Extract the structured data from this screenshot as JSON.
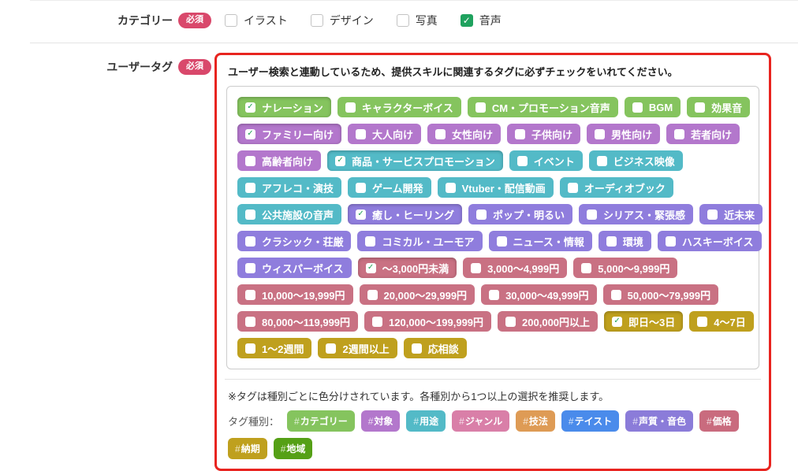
{
  "colors": {
    "category": "#85c45e",
    "target": "#b377cc",
    "usage": "#53bac7",
    "taste": "#8f7ddd",
    "voice": "#8f7ddd",
    "price": "#c97183",
    "delivery": "#bfa01e",
    "required_badge": "#d9486b",
    "panel_border": "#e8241f",
    "checkbox_checked_bg": "#1fa25e",
    "tag_check_green": "#1e9e53"
  },
  "category_row": {
    "label": "カテゴリー",
    "required_badge": "必須",
    "options": [
      {
        "label": "イラスト",
        "checked": false
      },
      {
        "label": "デザイン",
        "checked": false
      },
      {
        "label": "写真",
        "checked": false
      },
      {
        "label": "音声",
        "checked": true
      }
    ]
  },
  "user_tag_row": {
    "label": "ユーザータグ",
    "required_badge": "必須",
    "instruction": "ユーザー検索と連動しているため、提供スキルに関連するタグに必ずチェックをいれてください。",
    "tag_rows": [
      [
        {
          "label": "ナレーション",
          "checked": true,
          "group": "category"
        },
        {
          "label": "キャラクターボイス",
          "checked": false,
          "group": "category"
        },
        {
          "label": "CM・プロモーション音声",
          "checked": false,
          "group": "category"
        },
        {
          "label": "BGM",
          "checked": false,
          "group": "category"
        },
        {
          "label": "効果音",
          "checked": false,
          "group": "category"
        }
      ],
      [
        {
          "label": "ファミリー向け",
          "checked": true,
          "group": "target"
        },
        {
          "label": "大人向け",
          "checked": false,
          "group": "target"
        },
        {
          "label": "女性向け",
          "checked": false,
          "group": "target"
        },
        {
          "label": "子供向け",
          "checked": false,
          "group": "target"
        },
        {
          "label": "男性向け",
          "checked": false,
          "group": "target"
        },
        {
          "label": "若者向け",
          "checked": false,
          "group": "target"
        }
      ],
      [
        {
          "label": "高齢者向け",
          "checked": false,
          "group": "target"
        },
        {
          "label": "商品・サービスプロモーション",
          "checked": true,
          "group": "usage"
        },
        {
          "label": "イベント",
          "checked": false,
          "group": "usage"
        },
        {
          "label": "ビジネス映像",
          "checked": false,
          "group": "usage"
        }
      ],
      [
        {
          "label": "アフレコ・演技",
          "checked": false,
          "group": "usage"
        },
        {
          "label": "ゲーム開発",
          "checked": false,
          "group": "usage"
        },
        {
          "label": "Vtuber・配信動画",
          "checked": false,
          "group": "usage"
        },
        {
          "label": "オーディオブック",
          "checked": false,
          "group": "usage"
        }
      ],
      [
        {
          "label": "公共施設の音声",
          "checked": false,
          "group": "usage"
        },
        {
          "label": "癒し・ヒーリング",
          "checked": true,
          "group": "taste"
        },
        {
          "label": "ポップ・明るい",
          "checked": false,
          "group": "taste"
        },
        {
          "label": "シリアス・緊張感",
          "checked": false,
          "group": "taste"
        },
        {
          "label": "近未来",
          "checked": false,
          "group": "taste"
        }
      ],
      [
        {
          "label": "クラシック・荘厳",
          "checked": false,
          "group": "taste"
        },
        {
          "label": "コミカル・ユーモア",
          "checked": false,
          "group": "taste"
        },
        {
          "label": "ニュース・情報",
          "checked": false,
          "group": "taste"
        },
        {
          "label": "環境",
          "checked": false,
          "group": "taste"
        },
        {
          "label": "ハスキーボイス",
          "checked": false,
          "group": "voice"
        }
      ],
      [
        {
          "label": "ウィスパーボイス",
          "checked": false,
          "group": "voice"
        },
        {
          "label": "～3,000円未満",
          "checked": true,
          "group": "price"
        },
        {
          "label": "3,000～4,999円",
          "checked": false,
          "group": "price"
        },
        {
          "label": "5,000～9,999円",
          "checked": false,
          "group": "price"
        }
      ],
      [
        {
          "label": "10,000～19,999円",
          "checked": false,
          "group": "price"
        },
        {
          "label": "20,000～29,999円",
          "checked": false,
          "group": "price"
        },
        {
          "label": "30,000～49,999円",
          "checked": false,
          "group": "price"
        },
        {
          "label": "50,000～79,999円",
          "checked": false,
          "group": "price"
        }
      ],
      [
        {
          "label": "80,000～119,999円",
          "checked": false,
          "group": "price"
        },
        {
          "label": "120,000～199,999円",
          "checked": false,
          "group": "price"
        },
        {
          "label": "200,000円以上",
          "checked": false,
          "group": "price"
        },
        {
          "label": "即日～3日",
          "checked": true,
          "group": "delivery"
        },
        {
          "label": "4～7日",
          "checked": false,
          "group": "delivery"
        }
      ],
      [
        {
          "label": "1～2週間",
          "checked": false,
          "group": "delivery"
        },
        {
          "label": "2週間以上",
          "checked": false,
          "group": "delivery"
        },
        {
          "label": "応相談",
          "checked": false,
          "group": "delivery"
        }
      ]
    ],
    "note": "※タグは種別ごとに色分けされています。各種別から1つ以上の選択を推奨します。",
    "legend_label": "タグ種別：",
    "legend": [
      {
        "label": "#カテゴリー",
        "color": "#85c45e"
      },
      {
        "label": "#対象",
        "color": "#b377cc"
      },
      {
        "label": "#用途",
        "color": "#53bac7"
      },
      {
        "label": "#ジャンル",
        "color": "#d97fa8"
      },
      {
        "label": "#技法",
        "color": "#de9b55"
      },
      {
        "label": "#テイスト",
        "color": "#4a8beb"
      },
      {
        "label": "#声質・音色",
        "color": "#8b7cd9"
      },
      {
        "label": "#価格",
        "color": "#c96b7e"
      },
      {
        "label": "#納期",
        "color": "#bfa01e"
      },
      {
        "label": "#地域",
        "color": "#55a016"
      }
    ],
    "check_glyph": "✓"
  }
}
